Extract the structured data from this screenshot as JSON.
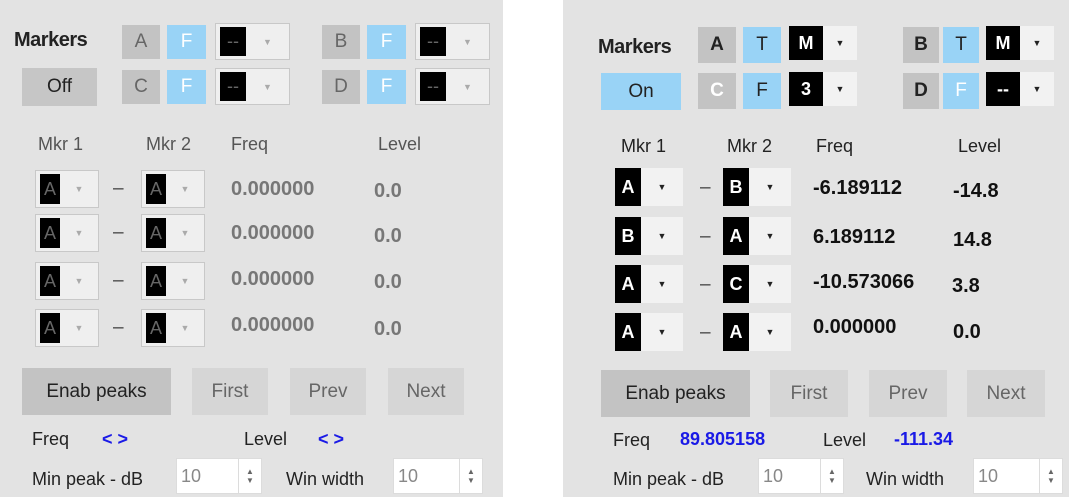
{
  "left": {
    "markers_title": "Markers",
    "toggle_label": "Off",
    "marker_slots": [
      {
        "letter": "A",
        "mode": "F",
        "select": "--"
      },
      {
        "letter": "B",
        "mode": "F",
        "select": "--"
      },
      {
        "letter": "C",
        "mode": "F",
        "select": "--"
      },
      {
        "letter": "D",
        "mode": "F",
        "select": "--"
      }
    ],
    "headers": {
      "mkr1": "Mkr 1",
      "mkr2": "Mkr 2",
      "freq": "Freq",
      "level": "Level"
    },
    "rows": [
      {
        "m1": "A",
        "dash": "–",
        "m2": "A",
        "freq": "0.000000",
        "level": "0.0"
      },
      {
        "m1": "A",
        "dash": "–",
        "m2": "A",
        "freq": "0.000000",
        "level": "0.0"
      },
      {
        "m1": "A",
        "dash": "–",
        "m2": "A",
        "freq": "0.000000",
        "level": "0.0"
      },
      {
        "m1": "A",
        "dash": "–",
        "m2": "A",
        "freq": "0.000000",
        "level": "0.0"
      }
    ],
    "buttons": {
      "enab_peaks": "Enab peaks",
      "first": "First",
      "prev": "Prev",
      "next": "Next"
    },
    "peak_info": {
      "freq_label": "Freq",
      "freq_value": "< >",
      "level_label": "Level",
      "level_value": "< >"
    },
    "min_peak": {
      "label": "Min peak - dB",
      "value": "10"
    },
    "win_width": {
      "label": "Win width",
      "value": "10"
    }
  },
  "right": {
    "markers_title": "Markers",
    "toggle_label": "On",
    "marker_slots": [
      {
        "letter": "A",
        "mode": "T",
        "select": "M"
      },
      {
        "letter": "B",
        "mode": "T",
        "select": "M"
      },
      {
        "letter": "C",
        "mode": "F",
        "select": "3"
      },
      {
        "letter": "D",
        "mode": "F",
        "select": "--"
      }
    ],
    "headers": {
      "mkr1": "Mkr 1",
      "mkr2": "Mkr 2",
      "freq": "Freq",
      "level": "Level"
    },
    "rows": [
      {
        "m1": "A",
        "dash": "–",
        "m2": "B",
        "freq": "-6.189112",
        "level": "-14.8"
      },
      {
        "m1": "B",
        "dash": "–",
        "m2": "A",
        "freq": "6.189112",
        "level": "14.8"
      },
      {
        "m1": "A",
        "dash": "–",
        "m2": "C",
        "freq": "-10.573066",
        "level": "3.8"
      },
      {
        "m1": "A",
        "dash": "–",
        "m2": "A",
        "freq": "0.000000",
        "level": "0.0"
      }
    ],
    "buttons": {
      "enab_peaks": "Enab peaks",
      "first": "First",
      "prev": "Prev",
      "next": "Next"
    },
    "peak_info": {
      "freq_label": "Freq",
      "freq_value": "89.805158",
      "level_label": "Level",
      "level_value": "-111.34"
    },
    "min_peak": {
      "label": "Min peak - dB",
      "value": "10"
    },
    "win_width": {
      "label": "Win width",
      "value": "10"
    }
  },
  "colors": {
    "panel_bg": "#e3e3e3",
    "accent_blue": "#99d3f6",
    "value_blue": "#1a1ae6",
    "marker_gray": "#c3c3c3"
  }
}
